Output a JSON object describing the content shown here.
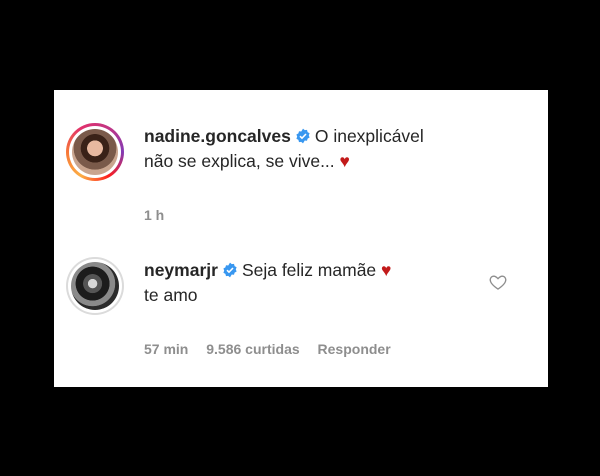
{
  "comments": [
    {
      "username": "nadine.goncalves",
      "text_line1": "O inexplicável",
      "text_line2": "não se explica, se vive...",
      "heart": "♥",
      "time": "1 h"
    },
    {
      "username": "neymarjr",
      "text_line1": "Seja feliz mamãe",
      "text_line2": "te amo",
      "heart": "♥",
      "time": "57 min",
      "likes": "9.586 curtidas",
      "reply": "Responder"
    }
  ],
  "colors": {
    "verified": "#3897f0",
    "heart": "#c21a1a",
    "meta": "#8e8e8e",
    "text": "#262626"
  }
}
